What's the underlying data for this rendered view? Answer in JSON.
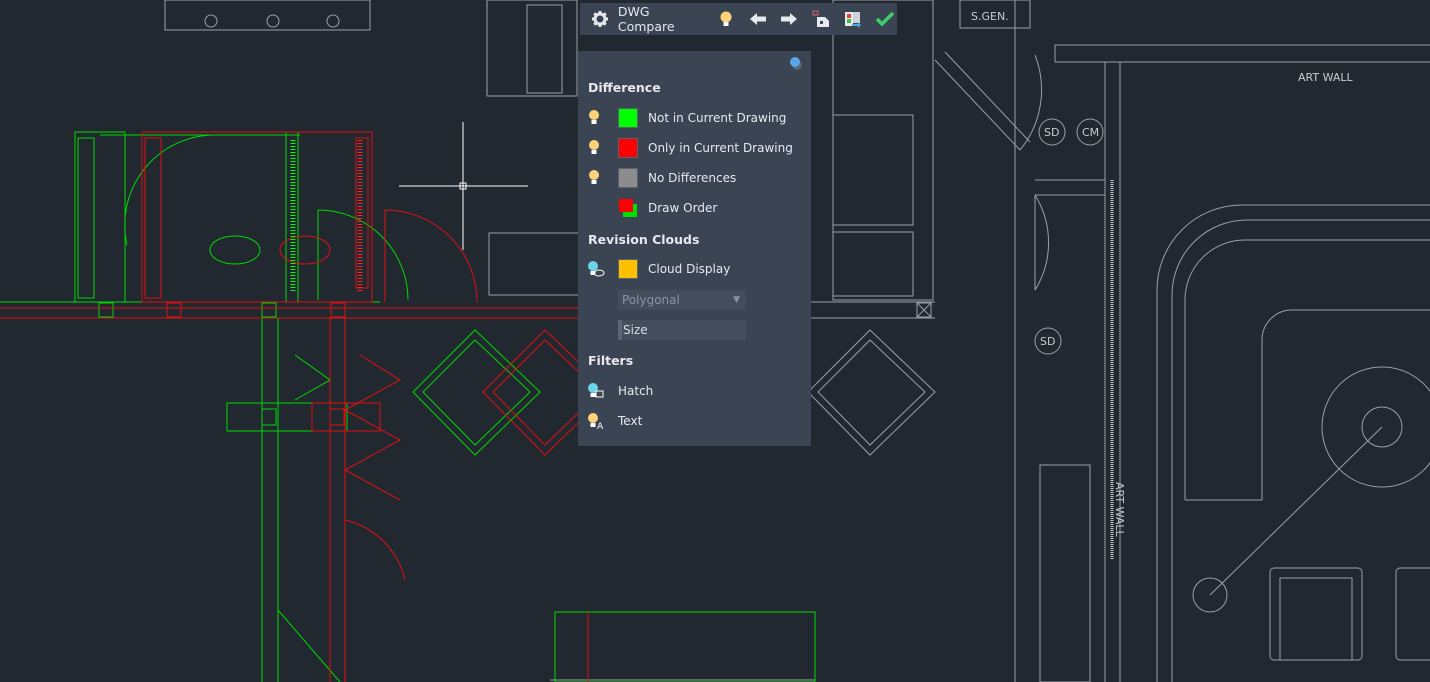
{
  "toolbar": {
    "title": "DWG Compare",
    "icons": [
      "settings-gear-icon",
      "lightbulb-icon",
      "previous-arrow-icon",
      "next-arrow-icon",
      "snapshot-icon",
      "export-compare-icon",
      "done-check-icon"
    ]
  },
  "panel": {
    "difference_heading": "Difference",
    "difference_items": [
      {
        "label": "Not in Current Drawing",
        "color": "#00ff00"
      },
      {
        "label": "Only in Current Drawing",
        "color": "#ff0000"
      },
      {
        "label": "No Differences",
        "color": "#8c8c8c"
      },
      {
        "label": "Draw Order"
      }
    ],
    "revision_heading": "Revision Clouds",
    "cloud_display": {
      "label": "Cloud Display",
      "color": "#ffc000"
    },
    "cloud_shape": "Polygonal",
    "cloud_size": "Size",
    "filters_heading": "Filters",
    "filters": [
      {
        "label": "Hatch"
      },
      {
        "label": "Text"
      }
    ]
  },
  "drawing": {
    "labels": {
      "sgen": "S.GEN.",
      "art_wall": "ART WALL",
      "art_wall_vertical": "ART WALL",
      "sd1": "SD",
      "cm": "CM",
      "sd2": "SD"
    }
  },
  "colors": {
    "background": "#212830",
    "panel": "#3b4453",
    "new": "#00ff00",
    "old": "#ff0000",
    "same": "#c8ccd0"
  }
}
